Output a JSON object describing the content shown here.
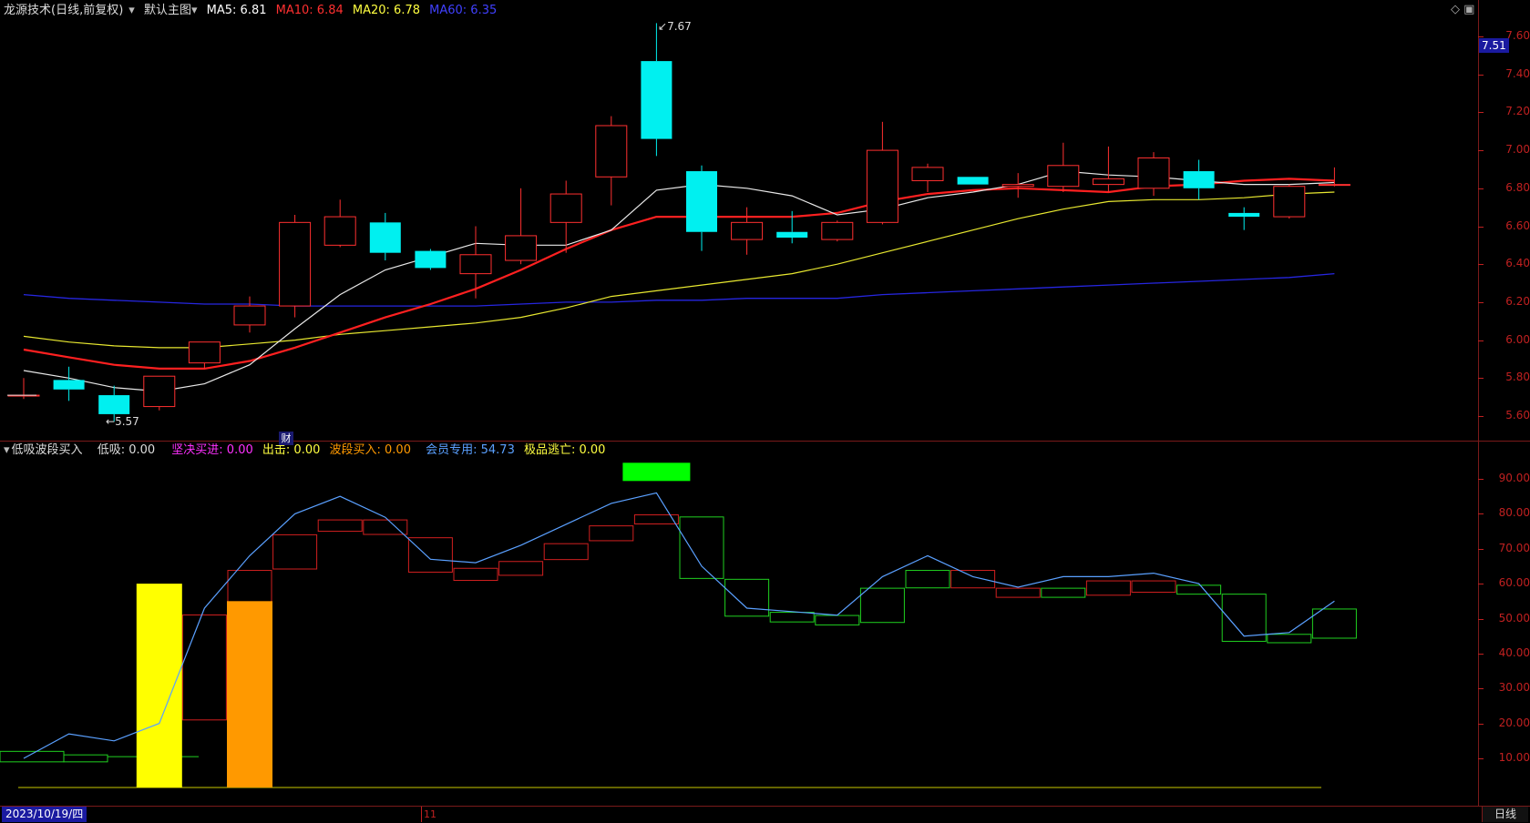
{
  "main_header": {
    "stock_name": "龙源技术",
    "period": "(日线,前复权)",
    "chart_selector": "默认主图",
    "ma5_label": "MA5: 6.81",
    "ma10_label": "MA10: 6.84",
    "ma20_label": "MA20: 6.78",
    "ma60_label": "MA60: 6.35",
    "colors": {
      "ma5": "#ffffff",
      "ma10": "#ff3030",
      "ma20": "#ffff40",
      "ma60": "#4040ff"
    }
  },
  "sub_header": {
    "indicator_name": "低吸波段买入",
    "dixi": "低吸: 0.00",
    "jianjue": "坚决买进: 0.00",
    "chuji": "出击: 0.00",
    "boduan": "波段买入: 0.00",
    "huiyuan": "会员专用: 54.73",
    "jipin": "极品逃亡: 0.00",
    "colors": {
      "dixi": "#dddddd",
      "jianjue": "#ff30ff",
      "chuji": "#ffff40",
      "boduan": "#ff9900",
      "huiyuan": "#5aa0ff",
      "jipin": "#ffff40"
    }
  },
  "price_axis": [
    "7.60",
    "7.40",
    "7.20",
    "7.00",
    "6.80",
    "6.60",
    "6.40",
    "6.20",
    "6.00",
    "5.80",
    "5.60"
  ],
  "price_badge": "7.51",
  "sub_axis": [
    "90.00",
    "80.00",
    "70.00",
    "60.00",
    "50.00",
    "40.00",
    "30.00",
    "20.00",
    "10.00"
  ],
  "annotations": {
    "high": "7.67",
    "low": "5.57",
    "cai": "财"
  },
  "bottom": {
    "date": "2023/10/19/四",
    "month": "11",
    "period_button": "日线"
  },
  "top_icons": "◇ ▣",
  "chart_data": {
    "type": "candlestick",
    "candles": [
      {
        "o": 5.71,
        "h": 5.8,
        "l": 5.69,
        "c": 5.71
      },
      {
        "o": 5.79,
        "h": 5.86,
        "l": 5.68,
        "c": 5.74
      },
      {
        "o": 5.71,
        "h": 5.76,
        "l": 5.57,
        "c": 5.61
      },
      {
        "o": 5.65,
        "h": 5.81,
        "l": 5.63,
        "c": 5.81
      },
      {
        "o": 5.88,
        "h": 5.98,
        "l": 5.85,
        "c": 5.99
      },
      {
        "o": 6.08,
        "h": 6.23,
        "l": 6.04,
        "c": 6.18
      },
      {
        "o": 6.18,
        "h": 6.66,
        "l": 6.12,
        "c": 6.62
      },
      {
        "o": 6.5,
        "h": 6.74,
        "l": 6.49,
        "c": 6.65
      },
      {
        "o": 6.62,
        "h": 6.67,
        "l": 6.42,
        "c": 6.46
      },
      {
        "o": 6.47,
        "h": 6.48,
        "l": 6.37,
        "c": 6.38
      },
      {
        "o": 6.35,
        "h": 6.6,
        "l": 6.22,
        "c": 6.45
      },
      {
        "o": 6.42,
        "h": 6.8,
        "l": 6.4,
        "c": 6.55
      },
      {
        "o": 6.62,
        "h": 6.84,
        "l": 6.46,
        "c": 6.77
      },
      {
        "o": 6.86,
        "h": 7.18,
        "l": 6.71,
        "c": 7.13
      },
      {
        "o": 7.47,
        "h": 7.67,
        "l": 6.97,
        "c": 7.06
      },
      {
        "o": 6.89,
        "h": 6.92,
        "l": 6.47,
        "c": 6.57
      },
      {
        "o": 6.53,
        "h": 6.7,
        "l": 6.45,
        "c": 6.62
      },
      {
        "o": 6.57,
        "h": 6.68,
        "l": 6.51,
        "c": 6.54
      },
      {
        "o": 6.53,
        "h": 6.63,
        "l": 6.52,
        "c": 6.62
      },
      {
        "o": 6.62,
        "h": 7.15,
        "l": 6.61,
        "c": 7.0
      },
      {
        "o": 6.84,
        "h": 6.93,
        "l": 6.78,
        "c": 6.91
      },
      {
        "o": 6.86,
        "h": 6.86,
        "l": 6.82,
        "c": 6.82
      },
      {
        "o": 6.81,
        "h": 6.88,
        "l": 6.75,
        "c": 6.82
      },
      {
        "o": 6.81,
        "h": 7.04,
        "l": 6.78,
        "c": 6.92
      },
      {
        "o": 6.82,
        "h": 7.02,
        "l": 6.78,
        "c": 6.85
      },
      {
        "o": 6.8,
        "h": 6.99,
        "l": 6.76,
        "c": 6.96
      },
      {
        "o": 6.89,
        "h": 6.95,
        "l": 6.74,
        "c": 6.8
      },
      {
        "o": 6.67,
        "h": 6.7,
        "l": 6.58,
        "c": 6.65
      },
      {
        "o": 6.65,
        "h": 6.82,
        "l": 6.64,
        "c": 6.81
      },
      {
        "o": 6.82,
        "h": 6.91,
        "l": 6.81,
        "c": 6.82
      }
    ],
    "ma5": [
      5.84,
      5.8,
      5.75,
      5.73,
      5.77,
      5.87,
      6.06,
      6.24,
      6.37,
      6.44,
      6.51,
      6.5,
      6.5,
      6.58,
      6.79,
      6.82,
      6.8,
      6.76,
      6.66,
      6.69,
      6.75,
      6.78,
      6.82,
      6.89,
      6.87,
      6.86,
      6.84,
      6.82,
      6.82,
      6.83
    ],
    "ma10": [
      5.95,
      5.91,
      5.87,
      5.85,
      5.85,
      5.89,
      5.96,
      6.04,
      6.12,
      6.19,
      6.27,
      6.37,
      6.48,
      6.58,
      6.65,
      6.65,
      6.65,
      6.65,
      6.67,
      6.73,
      6.77,
      6.79,
      6.8,
      6.79,
      6.78,
      6.81,
      6.82,
      6.84,
      6.85,
      6.84
    ],
    "ma20": [
      6.02,
      5.99,
      5.97,
      5.96,
      5.96,
      5.98,
      6.0,
      6.03,
      6.05,
      6.07,
      6.09,
      6.12,
      6.17,
      6.23,
      6.26,
      6.29,
      6.32,
      6.35,
      6.4,
      6.46,
      6.52,
      6.58,
      6.64,
      6.69,
      6.73,
      6.74,
      6.74,
      6.75,
      6.77,
      6.78
    ],
    "ma60": [
      6.24,
      6.22,
      6.21,
      6.2,
      6.19,
      6.19,
      6.18,
      6.18,
      6.18,
      6.18,
      6.18,
      6.19,
      6.2,
      6.2,
      6.21,
      6.21,
      6.22,
      6.22,
      6.22,
      6.24,
      6.25,
      6.26,
      6.27,
      6.28,
      6.29,
      6.3,
      6.31,
      6.32,
      6.33,
      6.35
    ],
    "price_ylim": [
      5.52,
      7.7
    ],
    "sub_ylim": [
      0,
      100
    ],
    "huiyuan": [
      10,
      17,
      15,
      20,
      53,
      68,
      80,
      85,
      79,
      67,
      66,
      71,
      77,
      83,
      86,
      65,
      53,
      52,
      51,
      62,
      68,
      62,
      59,
      62,
      62,
      63,
      60,
      45,
      46,
      55
    ],
    "yellow_bar": {
      "index": 3,
      "value": 60
    },
    "orange_bar": {
      "index": 5,
      "value": 55
    },
    "green_bar": {
      "index": 14,
      "value": 92
    }
  }
}
